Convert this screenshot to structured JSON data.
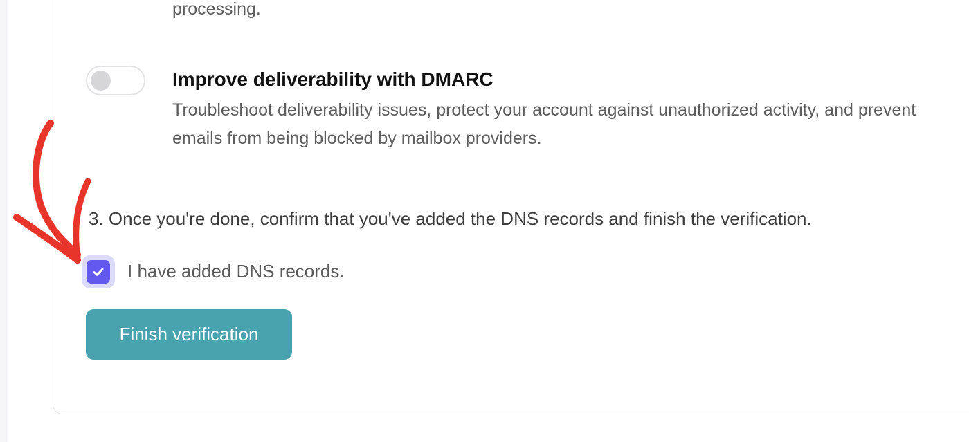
{
  "previous_feature": {
    "description_tail": "processing."
  },
  "dmarc": {
    "title": "Improve deliverability with DMARC",
    "description": "Troubleshoot deliverability issues, protect your account against unauthorized activity, and prevent emails from being blocked by mailbox providers.",
    "enabled": false
  },
  "step3": {
    "instruction": "3. Once you're done, confirm that you've added the DNS records and finish the verification.",
    "checkbox_label": "I have added DNS records.",
    "checked": true,
    "button_label": "Finish verification"
  },
  "colors": {
    "accent": "#6359ee",
    "button": "#48a3ae",
    "annotation_arrow": "#e8352b"
  }
}
